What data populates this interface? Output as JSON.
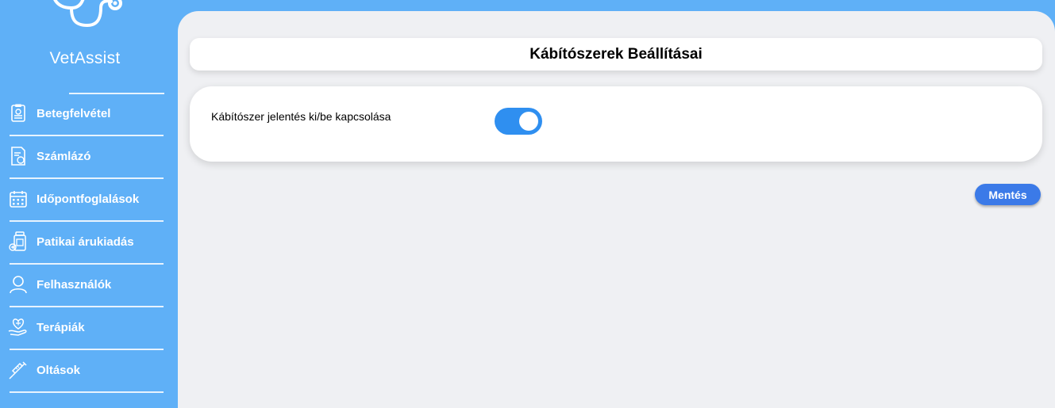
{
  "brand": {
    "name": "VetAssist"
  },
  "sidebar": {
    "items": [
      {
        "label": "Betegfelvétel",
        "icon": "clipboard-pet-icon"
      },
      {
        "label": "Számlázó",
        "icon": "invoice-icon"
      },
      {
        "label": "Időpontfoglalások",
        "icon": "calendar-icon"
      },
      {
        "label": "Patikai árukiadás",
        "icon": "medicine-bottle-icon"
      },
      {
        "label": "Felhasználók",
        "icon": "user-icon"
      },
      {
        "label": "Terápiák",
        "icon": "heart-hand-icon"
      },
      {
        "label": "Oltások",
        "icon": "syringe-icon"
      }
    ]
  },
  "main": {
    "title": "Kábítószerek Beállításai",
    "setting": {
      "label": "Kábítószer jelentés ki/be kapcsolása",
      "enabled": true
    },
    "save_label": "Mentés"
  },
  "colors": {
    "sidebar": "#5fb0f7",
    "toggle_on": "#2f8ff0",
    "button": "#3b7ae8",
    "content_bg": "#eff0f3"
  }
}
